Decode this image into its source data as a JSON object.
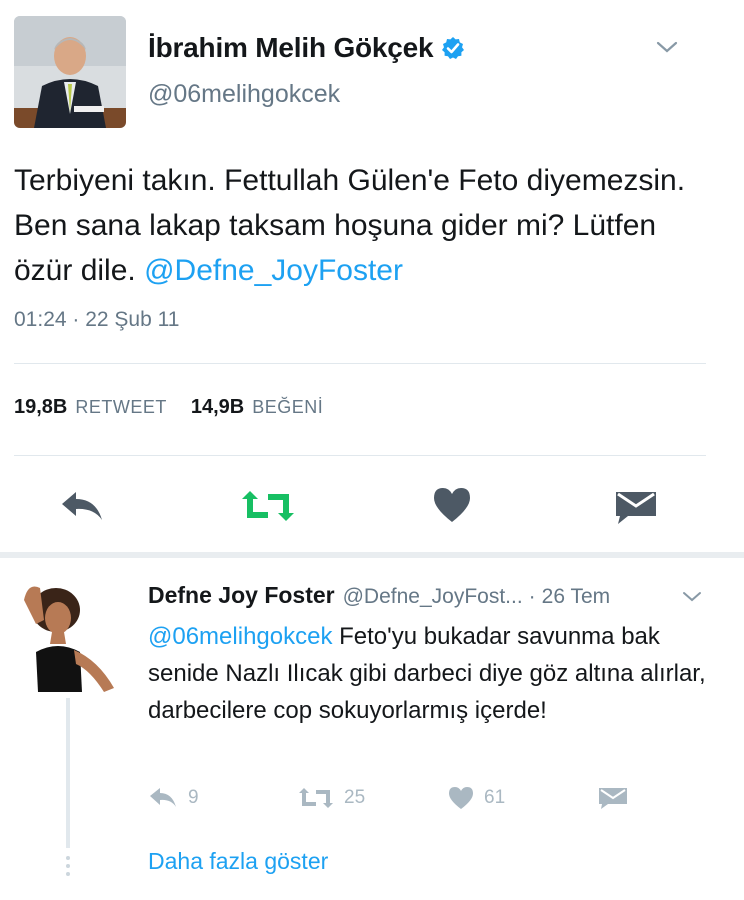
{
  "tweet": {
    "display_name": "İbrahim Melih Gökçek",
    "handle": "@06melihgokcek",
    "text_before": "Terbiyeni takın. Fettullah Gülen'e Feto diyemezsin. Ben sana lakap taksam hoşuna gider mi? Lütfen özür dile. ",
    "text_mention": "@Defne_JoyFoster",
    "timestamp": "01:24 · 22 Şub 11",
    "retweets_count": "19,8B",
    "retweets_label": "RETWEET",
    "likes_count": "14,9B",
    "likes_label": "BEĞENİ",
    "icons": [
      "reply-icon",
      "retweet-icon",
      "heart-icon",
      "message-icon",
      "verified-badge-icon",
      "chevron-down-icon"
    ],
    "colors": {
      "retweet_active": "#17bf63",
      "verified": "#1da1f2",
      "icon_gray": "#657786"
    }
  },
  "reply": {
    "display_name": "Defne Joy Foster",
    "handle": "@Defne_JoyFost...",
    "separator": "·",
    "time": "26 Tem",
    "mention": "@06melihgokcek",
    "text": " Feto'yu bukadar savunma bak senide Nazlı Ilıcak gibi darbeci diye göz altına alırlar, darbecilere cop sokuyorlarmış içerde!",
    "reply_count": "9",
    "retweet_count": "25",
    "like_count": "61",
    "show_more": "Daha fazla göster"
  },
  "colors": {
    "link": "#1da1f2",
    "text": "#14171a",
    "secondary": "#657786",
    "divider": "#e1e8ed"
  }
}
